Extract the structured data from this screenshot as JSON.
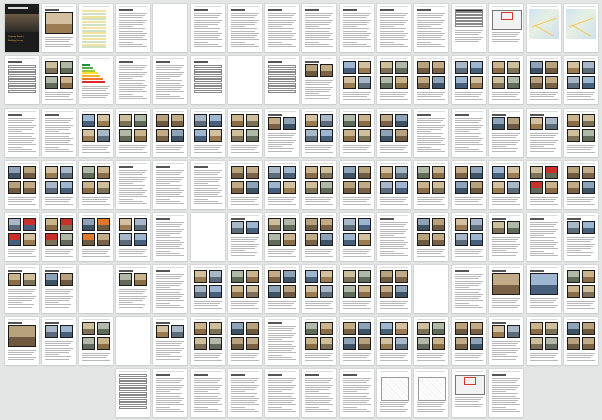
{
  "document": {
    "cover": {
      "lines": [
        "Property Report",
        "Building Survey"
      ]
    },
    "page_count": 127,
    "layout": {
      "row_tops": [
        4,
        56,
        109,
        161,
        213,
        265,
        317,
        369
      ],
      "row_lefts": [
        [
          5,
          42,
          79,
          116,
          153,
          191,
          228,
          265,
          302,
          340,
          377,
          414,
          452,
          489,
          527,
          564
        ],
        [
          5,
          42,
          79,
          116,
          153,
          191,
          228,
          265,
          302,
          340,
          377,
          414,
          452,
          489,
          527,
          564
        ],
        [
          5,
          42,
          79,
          116,
          153,
          191,
          228,
          265,
          302,
          340,
          377,
          414,
          452,
          489,
          527,
          564
        ],
        [
          5,
          42,
          79,
          116,
          153,
          191,
          228,
          265,
          302,
          340,
          377,
          414,
          452,
          489,
          527,
          564
        ],
        [
          5,
          42,
          79,
          116,
          153,
          191,
          228,
          265,
          302,
          340,
          377,
          414,
          452,
          489,
          527,
          564
        ],
        [
          5,
          42,
          79,
          116,
          153,
          191,
          228,
          265,
          302,
          340,
          377,
          414,
          452,
          489,
          527,
          564
        ],
        [
          5,
          42,
          79,
          116,
          153,
          191,
          228,
          265,
          302,
          340,
          377,
          414,
          452,
          489,
          527,
          564
        ],
        [
          116,
          153,
          191,
          228,
          265,
          302,
          340,
          377,
          414,
          452,
          489
        ]
      ]
    },
    "rows": [
      [
        "cover",
        "photo1",
        "list",
        "text",
        "blank",
        "text",
        "text",
        "text",
        "text",
        "text",
        "text",
        "text",
        "table",
        "plan",
        "map",
        "map"
      ],
      [
        "form",
        "photos4",
        "epc",
        "text",
        "text",
        "form",
        "blank",
        "form",
        "photos2",
        "photos4",
        "photos4",
        "photos4",
        "photos4",
        "photos4",
        "photos4",
        "photos4"
      ],
      [
        "text",
        "text",
        "photos4",
        "photos4",
        "photos4",
        "photos4",
        "photos4",
        "photos2",
        "photos4",
        "photos4",
        "photos4",
        "text",
        "text",
        "photos2",
        "photos2",
        "photos4"
      ],
      [
        "photos4",
        "photos4",
        "photos4",
        "text",
        "text",
        "text",
        "photos4",
        "photos4",
        "photos4",
        "photos4",
        "photos4",
        "photos4",
        "photos4",
        "photos4",
        "photos4red",
        "photos4"
      ],
      [
        "photos4red",
        "photos4red",
        "photos4orange",
        "photos4",
        "text",
        "blank",
        "photos2",
        "photos4",
        "photos4",
        "photos4",
        "text",
        "photos4",
        "photos4",
        "photos2",
        "text",
        "photos2"
      ],
      [
        "photos2",
        "photos2",
        "blank",
        "photos2",
        "text",
        "photos4",
        "photos4",
        "photos4",
        "photos4",
        "photos4",
        "photos4",
        "blank",
        "text",
        "photo1",
        "photo1",
        "photos4"
      ],
      [
        "photo1",
        "photos2",
        "photos4",
        "blank",
        "photos2",
        "photos4",
        "photos4",
        "text",
        "photos4",
        "photos4",
        "photos4",
        "photos4",
        "photos4",
        "photos2",
        "photos4",
        "photos4"
      ],
      [
        "tablelist",
        "text",
        "text",
        "text",
        "text",
        "text",
        "text",
        "sketch",
        "sketch",
        "plan",
        "text"
      ]
    ]
  }
}
